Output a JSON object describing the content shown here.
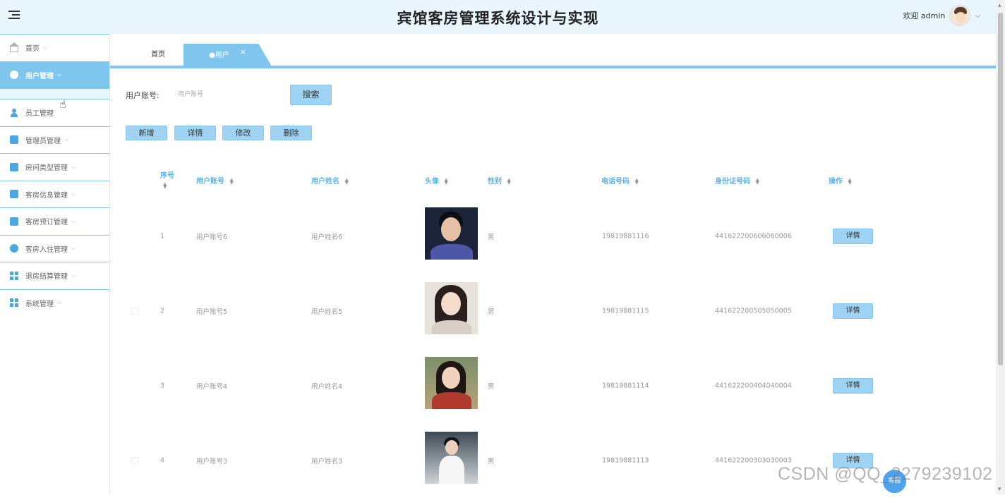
{
  "header": {
    "title": "宾馆客房管理系统设计与实现",
    "welcome": "欢迎 admin"
  },
  "sidebar": {
    "items": [
      {
        "label": "首页",
        "icon": "home-icon"
      },
      {
        "label": "用户管理",
        "icon": "user-manage-icon",
        "active": true
      },
      {
        "label": "员工管理",
        "icon": "staff-icon"
      },
      {
        "label": "管理员管理",
        "icon": "admin-icon"
      },
      {
        "label": "房间类型管理",
        "icon": "room-type-icon"
      },
      {
        "label": "客房信息管理",
        "icon": "room-info-icon"
      },
      {
        "label": "客房预订管理",
        "icon": "booking-icon"
      },
      {
        "label": "客房入住管理",
        "icon": "checkin-icon"
      },
      {
        "label": "退房结算管理",
        "icon": "checkout-icon"
      },
      {
        "label": "系统管理",
        "icon": "system-icon"
      }
    ]
  },
  "tabs": {
    "home": "首页",
    "active": "●用户",
    "close": "×"
  },
  "search": {
    "label": "用户账号:",
    "placeholder": "用户账号",
    "button": "搜索"
  },
  "actions": {
    "add": "新增",
    "detail": "详情",
    "edit": "修改",
    "delete": "删除"
  },
  "table": {
    "columns": {
      "seq": "序号",
      "account": "用户账号",
      "name": "用户姓名",
      "avatar": "头像",
      "gender": "性别",
      "phone": "电话号码",
      "idcard": "身份证号码",
      "ops": "操作"
    },
    "rows": [
      {
        "seq": "1",
        "account": "用户账号6",
        "name": "用户姓名6",
        "gender": "男",
        "phone": "19819881116",
        "idcard": "441622200606060006",
        "op": "详情"
      },
      {
        "seq": "2",
        "account": "用户账号5",
        "name": "用户姓名5",
        "gender": "男",
        "phone": "19819881115",
        "idcard": "441622200505050005",
        "op": "详情"
      },
      {
        "seq": "3",
        "account": "用户账号4",
        "name": "用户姓名4",
        "gender": "男",
        "phone": "19819881114",
        "idcard": "441622200404040004",
        "op": "详情"
      },
      {
        "seq": "4",
        "account": "用户账号3",
        "name": "用户姓名3",
        "gender": "男",
        "phone": "19819881113",
        "idcard": "441622200303030003",
        "op": "详情"
      }
    ]
  },
  "watermark": "CSDN @QQ_2279239102",
  "float_button": "客服",
  "colors": {
    "accent": "#7ec6ee",
    "header_bg": "#eaf6fd",
    "button": "#9ed3f4",
    "column_header": "#5ab4e8"
  }
}
